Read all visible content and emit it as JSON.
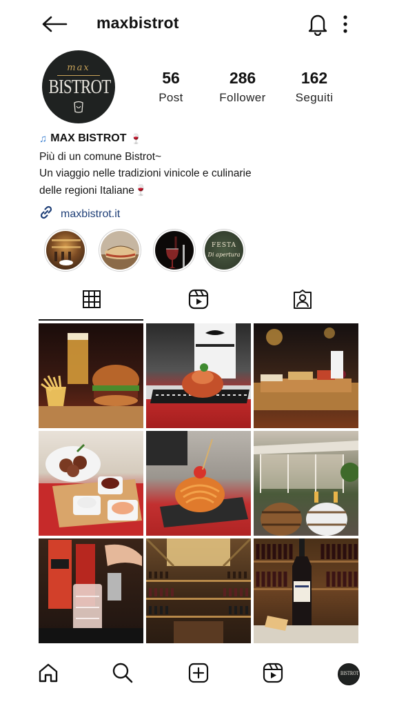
{
  "header": {
    "username": "maxbistrot"
  },
  "profile": {
    "avatar_small_text": "max",
    "avatar_main_text": "BISTROT",
    "stats": [
      {
        "value": "56",
        "label": "Post"
      },
      {
        "value": "286",
        "label": "Follower"
      },
      {
        "value": "162",
        "label": "Seguiti"
      }
    ],
    "bio": {
      "name": "MAX BISTROT",
      "name_prefix_icon": "music-notes-icon",
      "name_suffix_icon": "wine-glass-icon",
      "lines": [
        "Più di un comune Bistrot~",
        "Un viaggio nelle tradizioni vinicole e culinarie",
        "delle regioni Italiane🍷"
      ],
      "link": "maxbistrot.it"
    }
  },
  "highlights": [
    {
      "icon": "bar-interior-image",
      "text": ""
    },
    {
      "icon": "sandwich-image",
      "text": ""
    },
    {
      "icon": "wine-pour-image",
      "text": ""
    },
    {
      "icon": "festa-image",
      "text": "FESTA\nDi apertura"
    }
  ],
  "tabs": [
    {
      "icon": "grid-icon",
      "active": true
    },
    {
      "icon": "reels-icon",
      "active": false
    },
    {
      "icon": "tagged-icon",
      "active": false
    }
  ],
  "grid_posts": [
    "burger-and-fries",
    "fish-dish-wine",
    "cheese-board",
    "meatballs-sauces",
    "spaghetti-dish",
    "outdoor-terrace-barrels",
    "aperol-cocktail",
    "wine-cellar",
    "wine-shelf-bottle"
  ],
  "bottom_nav": [
    {
      "icon": "home-icon"
    },
    {
      "icon": "search-icon"
    },
    {
      "icon": "create-icon"
    },
    {
      "icon": "reels-icon"
    },
    {
      "icon": "profile-avatar"
    }
  ],
  "colors": {
    "link": "#1f3f77",
    "avatar_bg": "#1f2221",
    "avatar_gold": "#c9a45a"
  }
}
